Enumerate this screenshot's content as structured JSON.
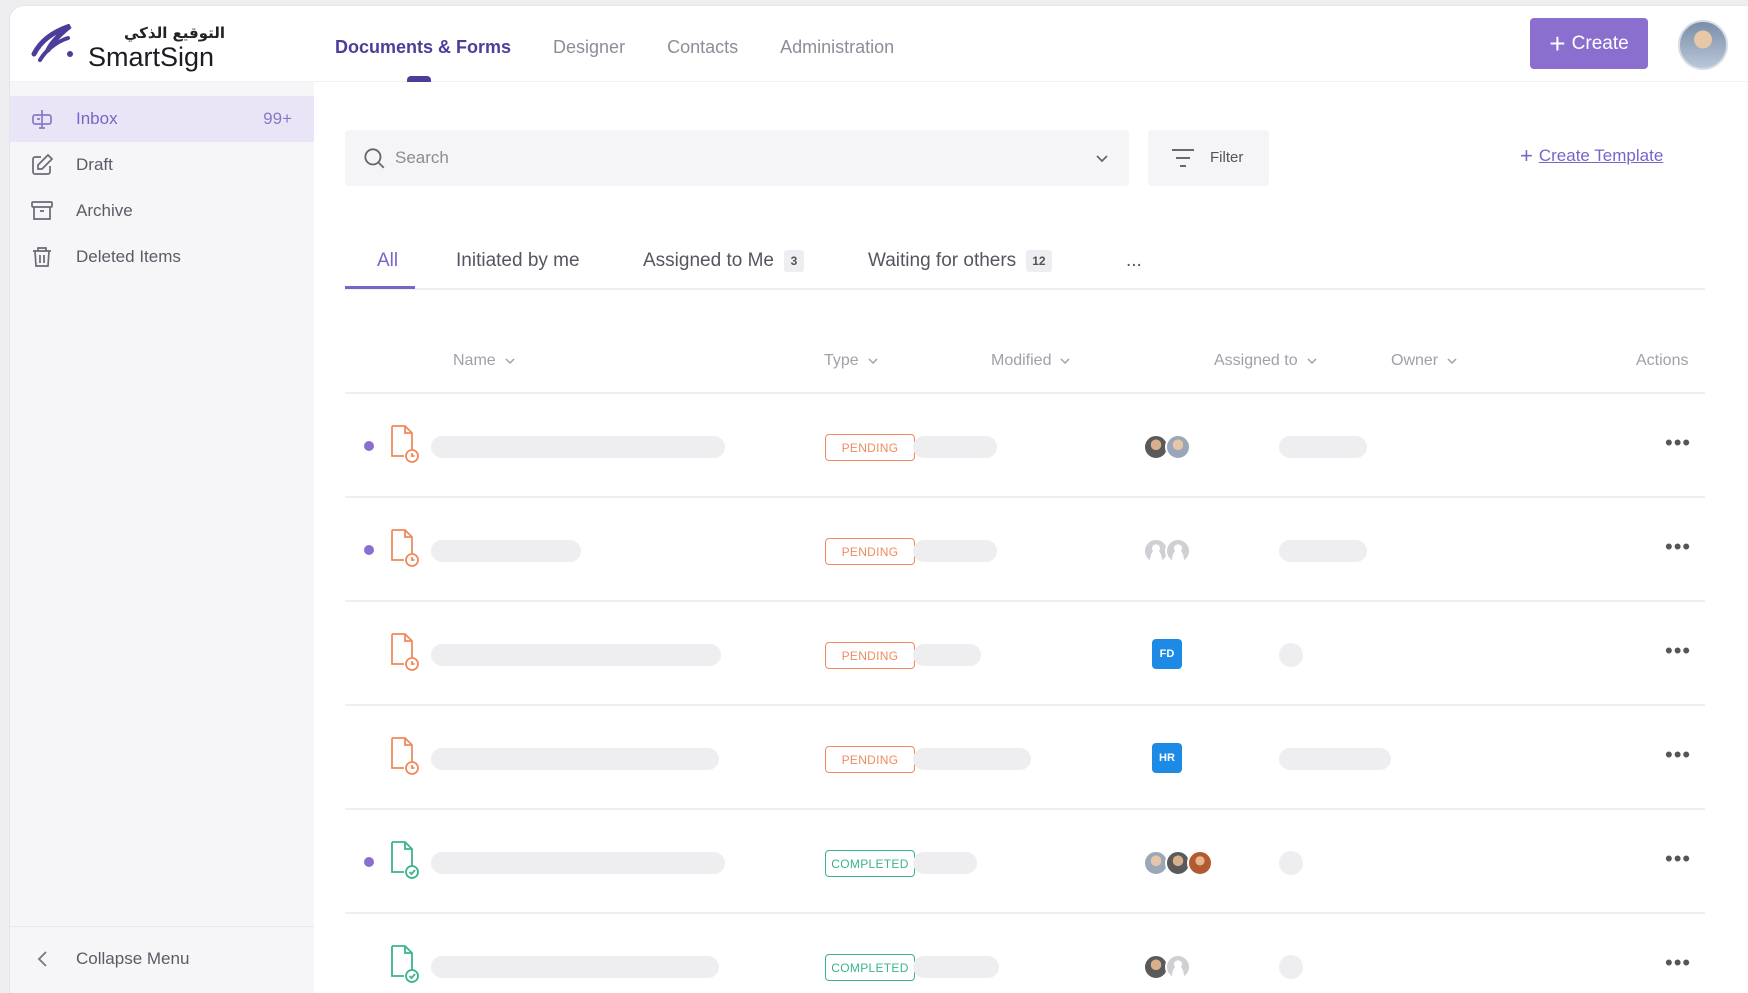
{
  "brand": {
    "arabic": "التوقيع الذكي",
    "name": "SmartSign",
    "accent": "#8a6fcf"
  },
  "topnav": [
    {
      "label": "Documents & Forms",
      "active": true
    },
    {
      "label": "Designer",
      "active": false
    },
    {
      "label": "Contacts",
      "active": false
    },
    {
      "label": "Administration",
      "active": false
    }
  ],
  "header": {
    "create_label": "Create"
  },
  "sidebar": {
    "items": [
      {
        "label": "Inbox",
        "count": "99+",
        "icon": "inbox-icon",
        "active": true
      },
      {
        "label": "Draft",
        "icon": "edit-icon",
        "active": false
      },
      {
        "label": "Archive",
        "icon": "archive-icon",
        "active": false
      },
      {
        "label": "Deleted Items",
        "icon": "trash-icon",
        "active": false
      }
    ],
    "collapse_label": "Collapse Menu"
  },
  "search": {
    "placeholder": "Search",
    "value": ""
  },
  "filter": {
    "label": "Filter"
  },
  "create_template": {
    "label": "Create Template"
  },
  "tabs": [
    {
      "label": "All",
      "active": true
    },
    {
      "label": "Initiated by me"
    },
    {
      "label": "Assigned to Me",
      "count": "3"
    },
    {
      "label": "Waiting for others",
      "count": "12"
    },
    {
      "label": "..."
    }
  ],
  "table": {
    "columns": [
      "Name",
      "Type",
      "Modified",
      "Assigned to",
      "Owner",
      "Actions"
    ],
    "rows": [
      {
        "unread": true,
        "status": "PENDING"
      },
      {
        "unread": true,
        "status": "PENDING"
      },
      {
        "unread": false,
        "status": "PENDING",
        "assignee": "FD"
      },
      {
        "unread": false,
        "status": "PENDING",
        "assignee": "HR"
      },
      {
        "unread": true,
        "status": "COMPLETED"
      },
      {
        "unread": false,
        "status": "COMPLETED"
      }
    ],
    "actions_label": "•••"
  },
  "colors": {
    "pending": "#f08a5d",
    "completed": "#3bb38f",
    "initials_bg": "#1d8ae5"
  }
}
